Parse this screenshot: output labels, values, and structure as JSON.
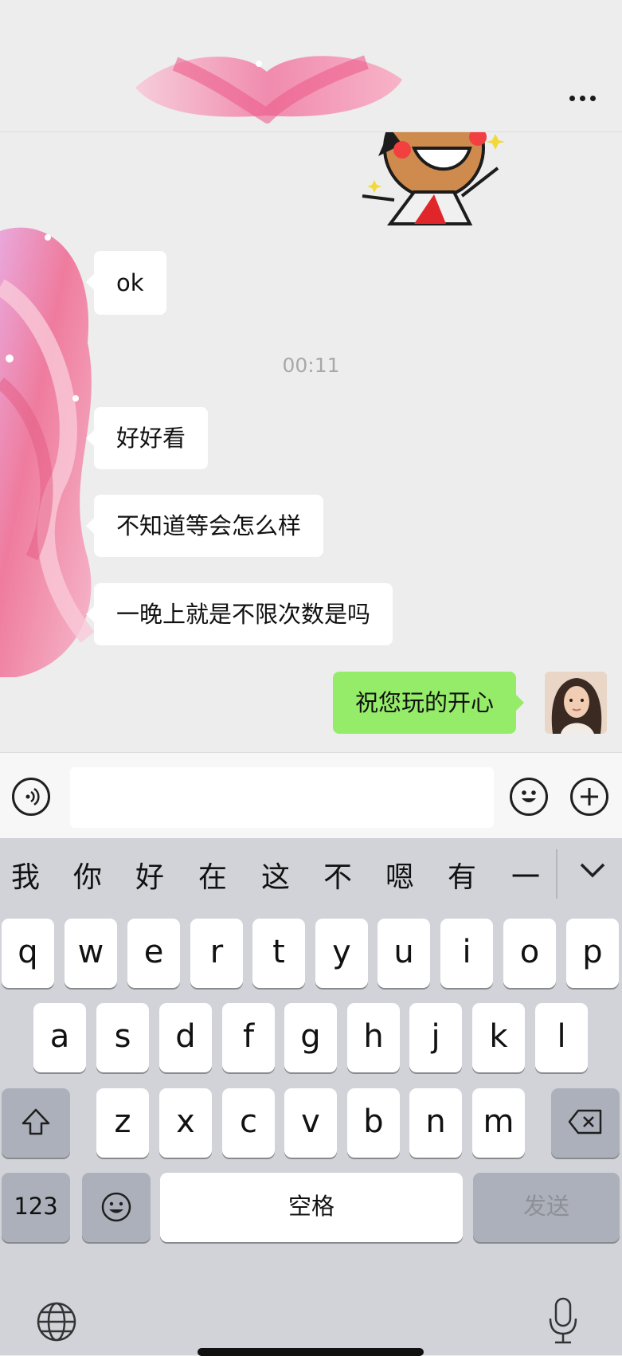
{
  "header": {
    "title": "",
    "more_icon": "more-dots-icon"
  },
  "messages": [
    {
      "side": "left",
      "text": "ok"
    },
    {
      "side": "center",
      "text": "00:11"
    },
    {
      "side": "left",
      "text": "好好看"
    },
    {
      "side": "left",
      "text": "不知道等会怎么样"
    },
    {
      "side": "left",
      "text": "一晚上就是不限次数是吗"
    },
    {
      "side": "right",
      "text": "祝您玩的开心"
    }
  ],
  "input_bar": {
    "voice_icon": "voice-icon",
    "value": "",
    "emoji_icon": "emoji-icon",
    "plus_icon": "plus-icon"
  },
  "keyboard": {
    "candidates": [
      "我",
      "你",
      "好",
      "在",
      "这",
      "不",
      "嗯",
      "有",
      "一"
    ],
    "row1": [
      "q",
      "w",
      "e",
      "r",
      "t",
      "y",
      "u",
      "i",
      "o",
      "p"
    ],
    "row2": [
      "a",
      "s",
      "d",
      "f",
      "g",
      "h",
      "j",
      "k",
      "l"
    ],
    "row3": [
      "z",
      "x",
      "c",
      "v",
      "b",
      "n",
      "m"
    ],
    "numbers_label": "123",
    "space_label": "空格",
    "send_label": "发送"
  },
  "colors": {
    "background": "#ededed",
    "sent_bubble": "#95ec69",
    "received_bubble": "#ffffff",
    "keyboard_bg": "#d1d3d9"
  }
}
